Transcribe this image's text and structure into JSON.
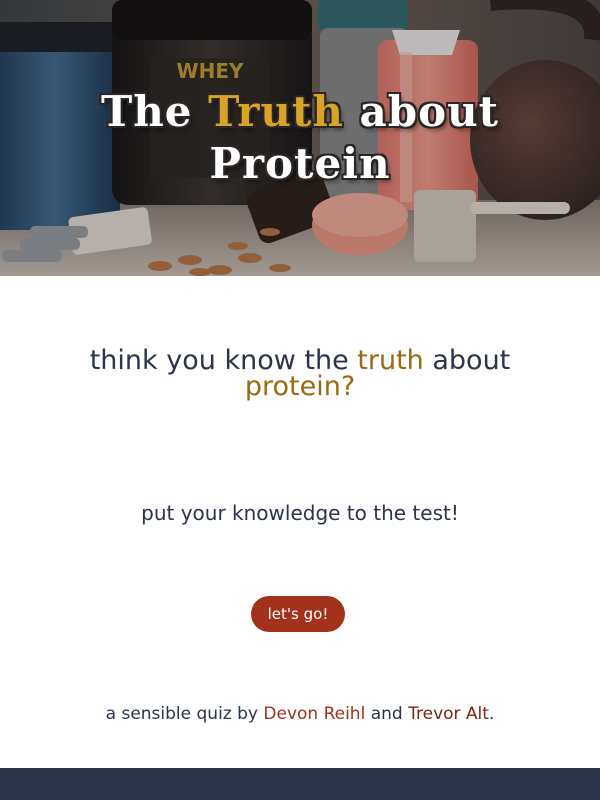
{
  "hero": {
    "title_part1": "The ",
    "title_accent": "Truth",
    "title_part2": " about",
    "title_line2": "Protein",
    "jar_label": "WHEY"
  },
  "main": {
    "question_part1": "think you know the ",
    "question_accent1": "truth",
    "question_part2": " about",
    "question_accent2": "protein?",
    "subtitle": "put your knowledge to the test!",
    "cta_label": "let's go!",
    "credits_prefix": "a sensible quiz by ",
    "author1": "Devon Reihl",
    "credits_joiner": " and ",
    "author2": "Trevor Alt",
    "credits_suffix": "."
  },
  "colors": {
    "text": "#2b344a",
    "accent_gold": "#d9a425",
    "question_accent": "#9b6a12",
    "button": "#a2321c",
    "author": "#a2321c",
    "footer": "#2c3549"
  }
}
